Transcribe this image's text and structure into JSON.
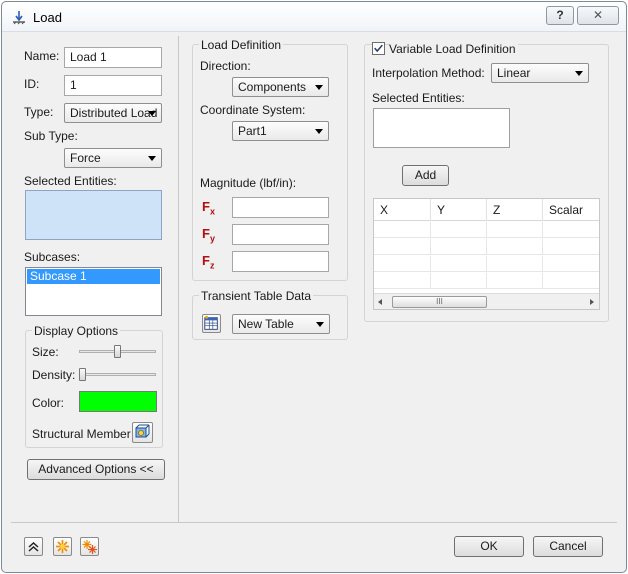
{
  "window": {
    "title": "Load",
    "help_label": "?",
    "close_label": "✕"
  },
  "left": {
    "name_label": "Name:",
    "name_value": "Load 1",
    "id_label": "ID:",
    "id_value": "1",
    "type_label": "Type:",
    "type_value": "Distributed Load",
    "subtype_label": "Sub Type:",
    "subtype_value": "Force",
    "selected_entities_label": "Selected Entities:",
    "subcases_label": "Subcases:",
    "subcases": [
      "Subcase 1"
    ],
    "display_options": {
      "title": "Display Options",
      "size_label": "Size:",
      "size_level": 0.5,
      "density_label": "Density:",
      "density_level": 0.0,
      "color_label": "Color:",
      "color_value": "#00ff00",
      "structural_member_label": "Structural Member"
    },
    "advanced_button": "Advanced Options <<"
  },
  "load_definition": {
    "title": "Load Definition",
    "direction_label": "Direction:",
    "direction_value": "Components",
    "coord_label": "Coordinate System:",
    "coord_value": "Part1",
    "magnitude_label": "Magnitude (lbf/in):",
    "fx_main": "F",
    "fx_sub": "x",
    "fx_value": "",
    "fy_main": "F",
    "fy_sub": "y",
    "fy_value": "",
    "fz_main": "F",
    "fz_sub": "z",
    "fz_value": ""
  },
  "transient": {
    "title": "Transient Table Data",
    "table_value": "New Table"
  },
  "variable": {
    "checkbox_label": "Variable Load Definition",
    "checked": true,
    "interp_label": "Interpolation Method:",
    "interp_value": "Linear",
    "selected_entities_label": "Selected Entities:",
    "add_button": "Add",
    "columns": [
      "X",
      "Y",
      "Z",
      "Scalar"
    ],
    "scroll_thumb_glyph": "III"
  },
  "footer": {
    "ok_label": "OK",
    "cancel_label": "Cancel"
  },
  "colors": {
    "selection": "#3399ff",
    "entity_box": "#cfe3f8"
  }
}
